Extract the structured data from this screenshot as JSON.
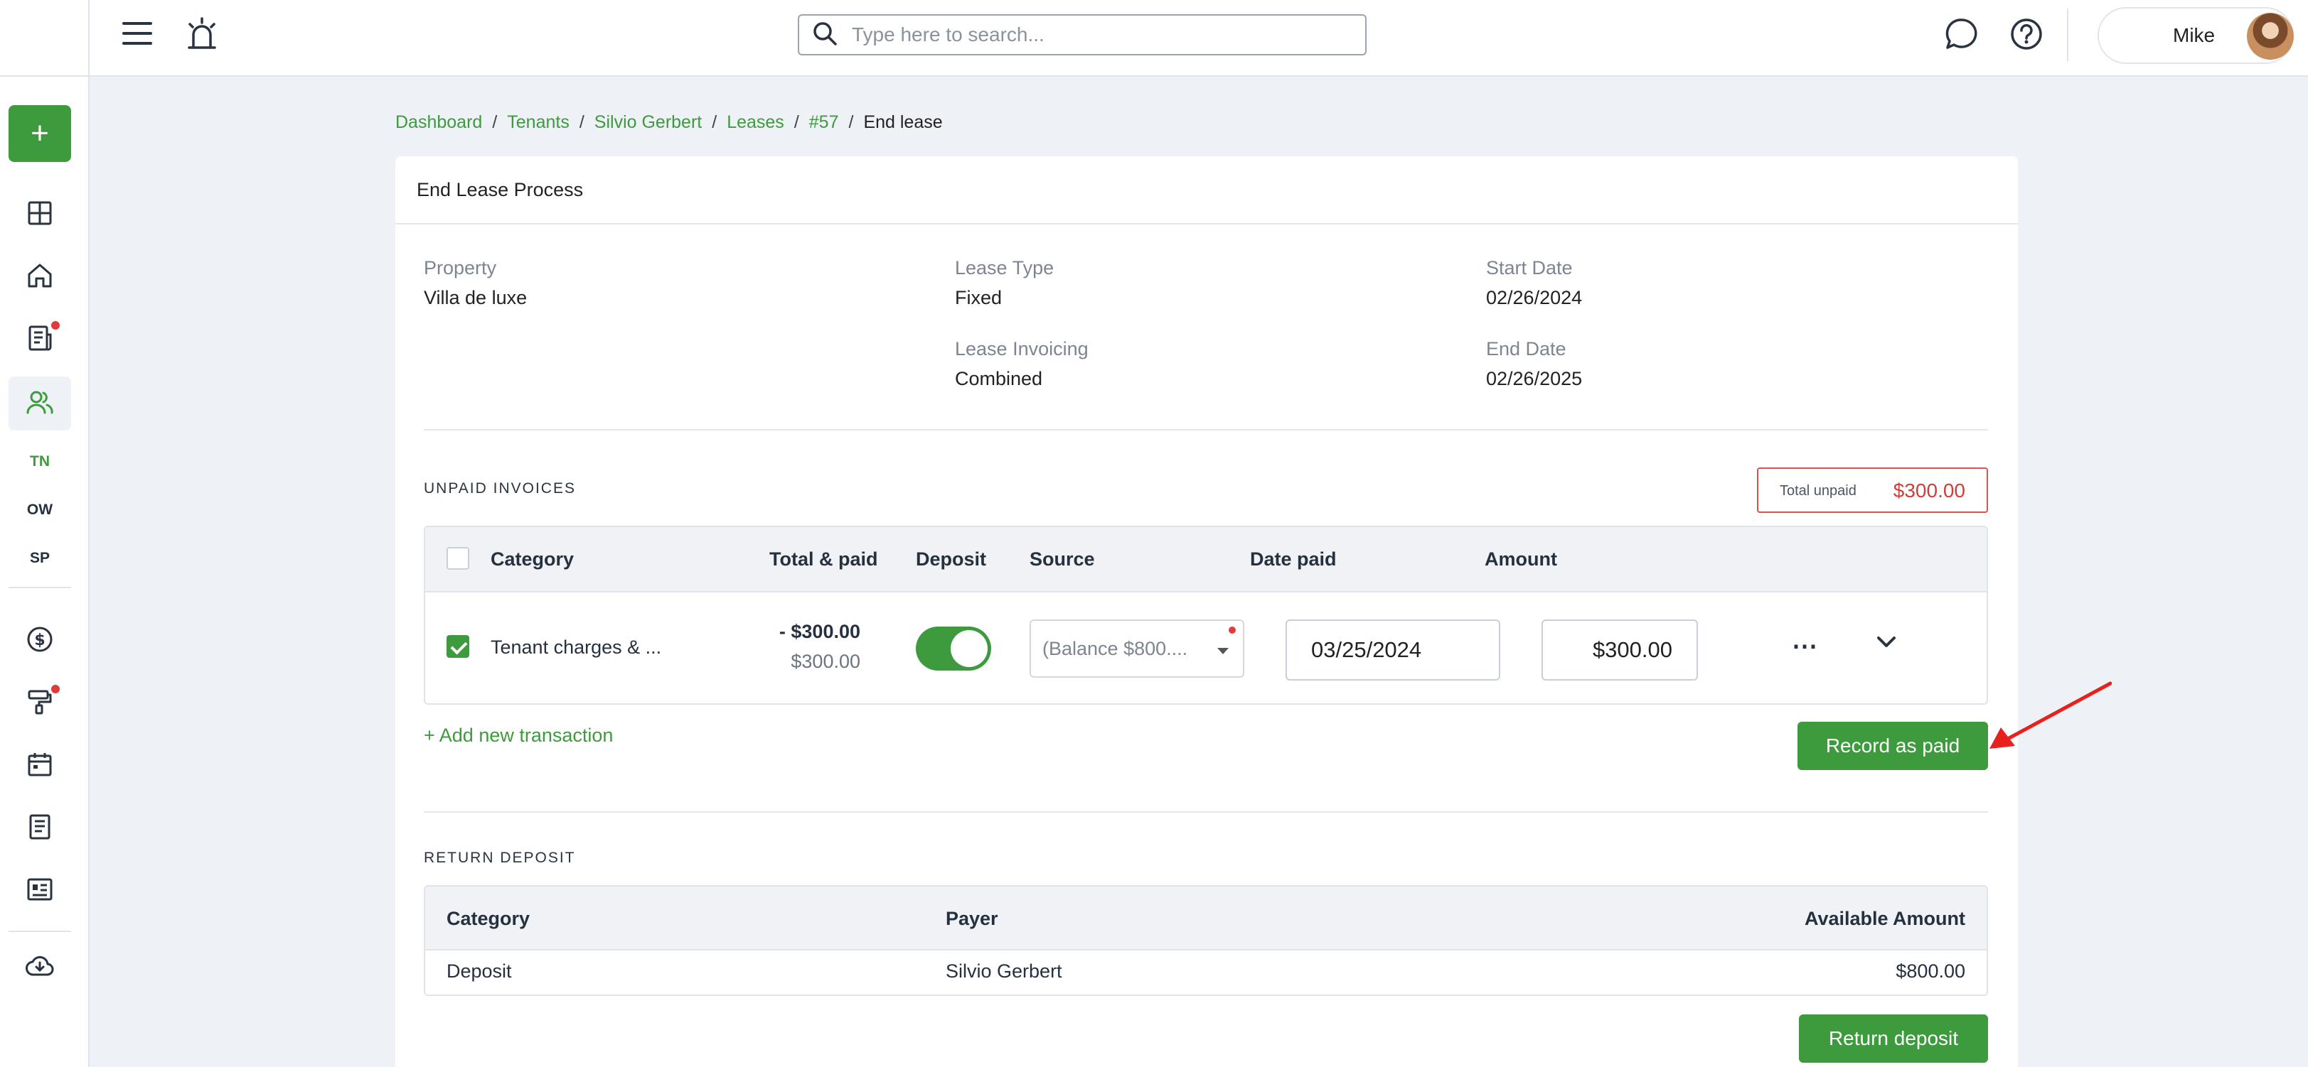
{
  "topbar": {
    "search_placeholder": "Type here to search...",
    "user_name": "Mike"
  },
  "sidebar": {
    "items": [
      {
        "icon": "dashboard-grid-icon"
      },
      {
        "icon": "home-icon"
      },
      {
        "icon": "document-icon",
        "badge": true
      },
      {
        "icon": "users-icon",
        "active": true
      },
      {
        "label": "TN"
      },
      {
        "label": "OW"
      },
      {
        "label": "SP"
      },
      {
        "icon": "dollar-icon"
      },
      {
        "icon": "paint-roller-icon",
        "badge": true
      },
      {
        "icon": "calendar-icon"
      },
      {
        "icon": "file-icon"
      },
      {
        "icon": "listing-icon"
      },
      {
        "icon": "cloud-download-icon"
      }
    ]
  },
  "breadcrumb": {
    "items": [
      "Dashboard",
      "Tenants",
      "Silvio Gerbert",
      "Leases",
      "#57"
    ],
    "separator": "/",
    "current": "End lease"
  },
  "card": {
    "title": "End Lease Process",
    "info": {
      "property_label": "Property",
      "property_value": "Villa de luxe",
      "lease_type_label": "Lease Type",
      "lease_type_value": "Fixed",
      "start_date_label": "Start Date",
      "start_date_value": "02/26/2024",
      "lease_invoicing_label": "Lease Invoicing",
      "lease_invoicing_value": "Combined",
      "end_date_label": "End Date",
      "end_date_value": "02/26/2025"
    }
  },
  "unpaid": {
    "section_title": "UNPAID INVOICES",
    "total_label": "Total unpaid",
    "total_value": "$300.00",
    "columns": {
      "category": "Category",
      "total_paid": "Total & paid",
      "deposit": "Deposit",
      "source": "Source",
      "date_paid": "Date paid",
      "amount": "Amount"
    },
    "rows": [
      {
        "category": "Tenant charges & ...",
        "total": "- $300.00",
        "paid": "$300.00",
        "deposit_on": true,
        "source": "(Balance $800....",
        "date_paid": "03/25/2024",
        "amount": "$300.00"
      }
    ],
    "more_icon": "⋯",
    "add_transaction": "+ Add new transaction",
    "record_button": "Record as paid"
  },
  "deposit": {
    "section_title": "RETURN DEPOSIT",
    "columns": {
      "category": "Category",
      "payer": "Payer",
      "available": "Available Amount"
    },
    "rows": [
      {
        "category": "Deposit",
        "payer": "Silvio Gerbert",
        "available": "$800.00"
      }
    ],
    "return_button": "Return deposit"
  },
  "colors": {
    "brand_green": "#3d9b3d",
    "alert_red": "#cf3f3a",
    "annotation_arrow": "#e8211c"
  }
}
